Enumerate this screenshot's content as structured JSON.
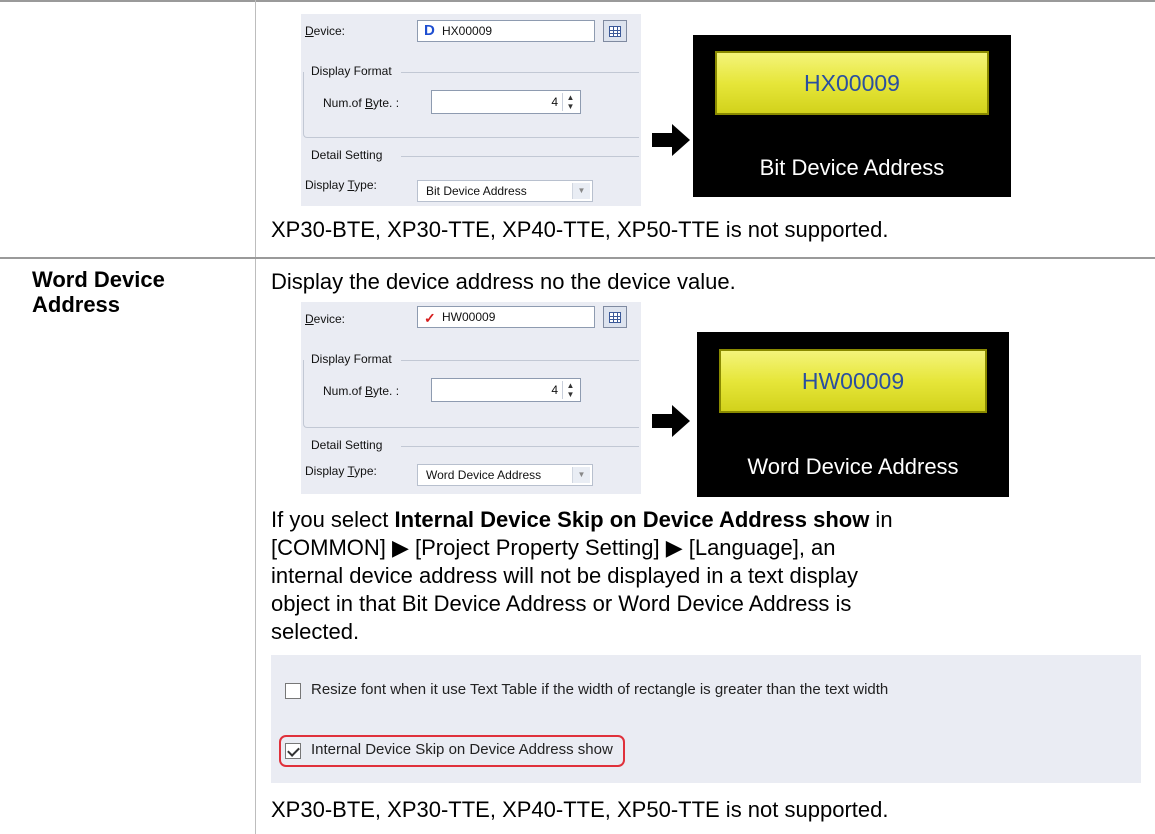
{
  "bit_section": {
    "dialog": {
      "device_label": "Device:",
      "device_value": "HX00009",
      "display_format_label": "Display Format",
      "num_of_byte_label": "Num.of Byte. :",
      "num_of_byte_value": "4",
      "detail_setting_label": "Detail Setting",
      "display_type_label": "Display Type:",
      "display_type_value": "Bit Device Address"
    },
    "preview": {
      "button_text": "HX00009",
      "caption": "Bit Device Address"
    },
    "note": "XP30-BTE, XP30-TTE, XP40-TTE, XP50-TTE is not supported."
  },
  "word_section": {
    "header": "Word Device Address",
    "description": "Display the device address no the device value.",
    "dialog": {
      "device_label": "Device:",
      "device_value": "HW00009",
      "display_format_label": "Display Format",
      "num_of_byte_label": "Num.of Byte. :",
      "num_of_byte_value": "4",
      "detail_setting_label": "Detail Setting",
      "display_type_label": "Display Type:",
      "display_type_value": "Word Device Address"
    },
    "preview": {
      "button_text": "HW00009",
      "caption": "Word Device Address"
    },
    "info": {
      "pre": "If you select ",
      "bold": "Internal Device Skip on Device Address show",
      "post": " in",
      "line2": "[COMMON] ▶ [Project Property Setting] ▶ [Language], an",
      "line3": "internal device address will not be displayed in a text display",
      "line4": "object in that Bit Device Address or Word Device Address is",
      "line5": "selected."
    },
    "options": {
      "resize_font_label": "Resize font when it use Text Table if the width of rectangle is greater than the text width",
      "resize_font_checked": false,
      "internal_skip_label": "Internal Device Skip on Device Address show",
      "internal_skip_checked": true
    },
    "note": "XP30-BTE, XP30-TTE, XP40-TTE, XP50-TTE is not supported."
  }
}
